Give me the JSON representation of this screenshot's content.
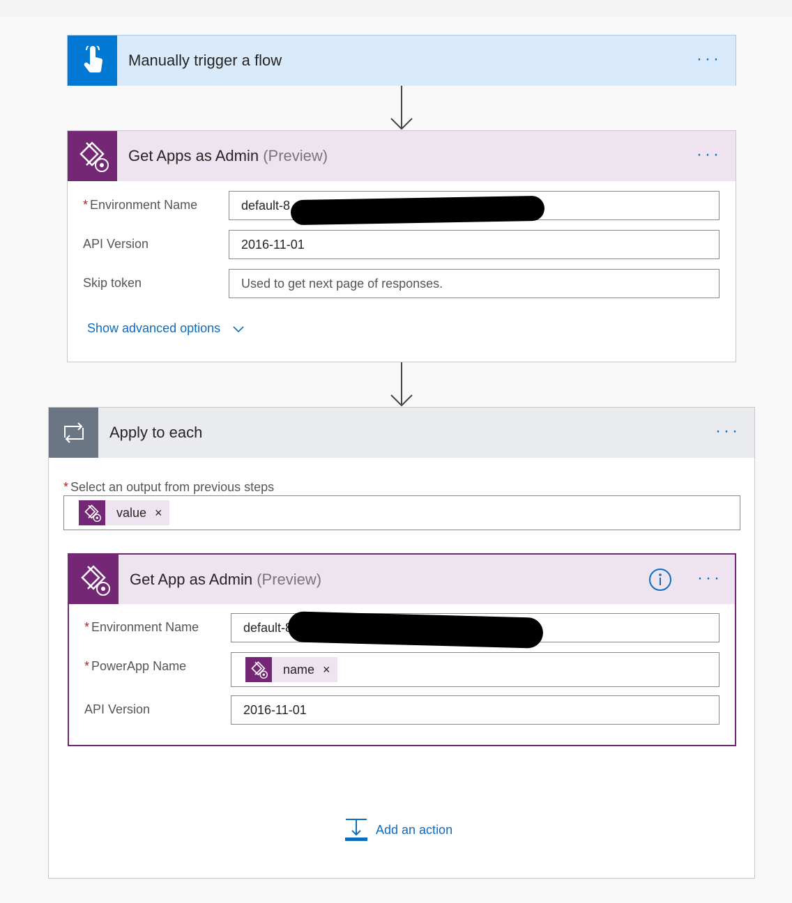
{
  "trigger": {
    "title": "Manually trigger a flow",
    "more": "···",
    "icon": "touch-hand-icon",
    "accent": "#0078d4",
    "header_bg": "#d9ebfb"
  },
  "get_apps": {
    "title": "Get Apps as Admin",
    "preview": "(Preview)",
    "more": "···",
    "icon": "powerapps-admin-icon",
    "accent": "#742774",
    "header_bg": "#eee4ef",
    "fields": {
      "env_label": "Environment Name",
      "env_value": "default-8",
      "api_label": "API Version",
      "api_value": "2016-11-01",
      "skip_label": "Skip token",
      "skip_placeholder": "Used to get next page of responses."
    },
    "advanced": "Show advanced options"
  },
  "apply_each": {
    "title": "Apply to each",
    "more": "···",
    "icon": "loop-icon",
    "accent": "#6a7683",
    "header_bg": "#e9ebee",
    "select_label": "Select an output from previous steps",
    "token": "value",
    "token_close": "×"
  },
  "get_app": {
    "title": "Get App as Admin",
    "preview": "(Preview)",
    "more": "···",
    "info": "i",
    "icon": "powerapps-admin-icon",
    "fields": {
      "env_label": "Environment Name",
      "env_value": "default-8",
      "app_label": "PowerApp Name",
      "app_token": "name",
      "app_token_close": "×",
      "api_label": "API Version",
      "api_value": "2016-11-01"
    }
  },
  "add_action": "Add an action",
  "required_mark": "*"
}
